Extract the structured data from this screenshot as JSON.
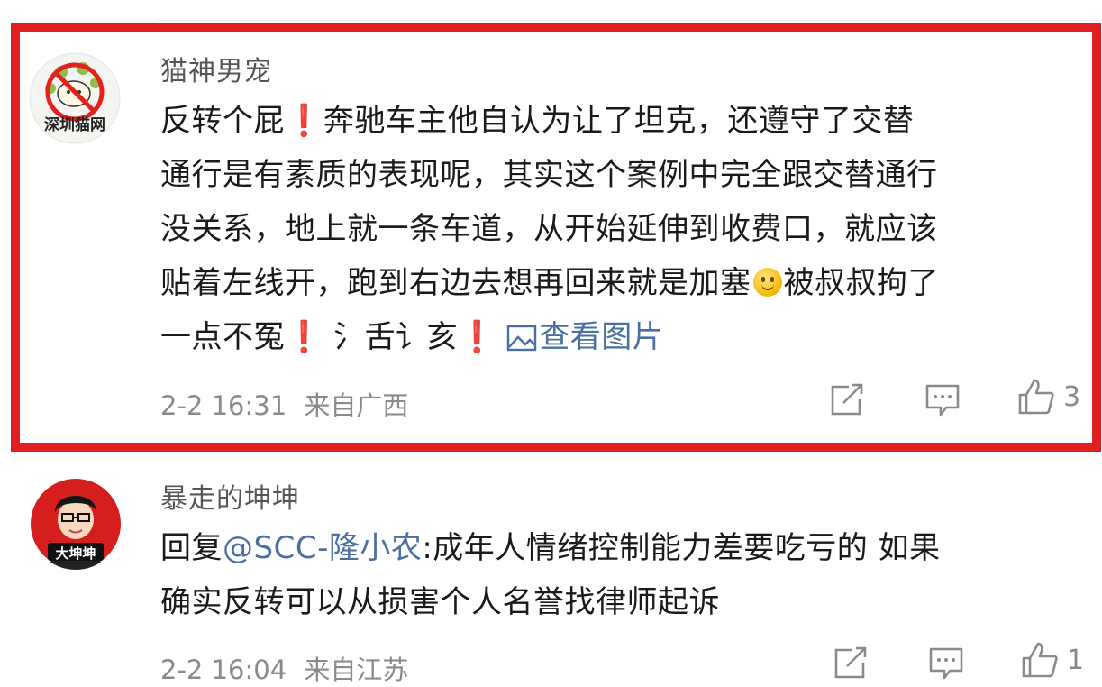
{
  "comments": [
    {
      "username": "猫神男宠",
      "avatar_icon": "cat-prohibited-avatar-icon",
      "avatar_caption": "深圳猫网",
      "lines": [
        {
          "a": "反转个屁",
          "excl": "❗",
          "b": "奔驰车主他自认为让了坦克，还遵守了交替"
        },
        {
          "a": "通行是有素质的表现呢，其实这个案例中完全跟交替通行"
        },
        {
          "a": "没关系，地上就一条车道，从开始延伸到收费口，就应该"
        },
        {
          "a": "贴着左线开，跑到右边去想再回来就是加塞",
          "emoji": "smile-emoji-icon",
          "b": "被叔叔拘了"
        },
        {
          "a": "一点不冤",
          "excl1": "❗",
          "b": "氵舌讠亥",
          "excl2": "❗",
          "link": "查看图片"
        }
      ],
      "view_image_icon": "image-icon",
      "timestamp": "2-2 16:31",
      "location": "来自广西",
      "like_count": "3"
    },
    {
      "username": "暴走的坤坤",
      "avatar_icon": "cartoon-man-avatar-icon",
      "avatar_caption": "大坤坤",
      "reply_prefix": "回复",
      "mention": "@SCC-隆小农",
      "line1_rest": ":成年人情绪控制能力差要吃亏的 如果",
      "line2": "确实反转可以从损害个人名誉找律师起诉",
      "timestamp": "2-2 16:04",
      "location": "来自江苏",
      "like_count": "1"
    }
  ],
  "action_icons": [
    "share-icon",
    "comment-icon",
    "like-icon"
  ],
  "highlight_color": "#e02020",
  "link_color": "#4a6fa0"
}
